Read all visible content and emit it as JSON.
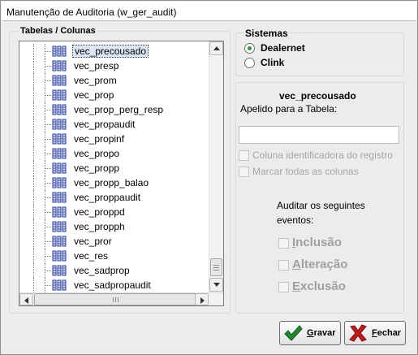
{
  "window": {
    "title": "Manutenção de Auditoria (w_ger_audit)"
  },
  "tables_group": {
    "label": "Tabelas / Colunas",
    "items": [
      {
        "label": "vec_precousado",
        "selected": true
      },
      {
        "label": "vec_presp"
      },
      {
        "label": "vec_prom"
      },
      {
        "label": "vec_prop"
      },
      {
        "label": "vec_prop_perg_resp"
      },
      {
        "label": "vec_propaudit"
      },
      {
        "label": "vec_propinf"
      },
      {
        "label": "vec_propo"
      },
      {
        "label": "vec_propp"
      },
      {
        "label": "vec_propp_balao"
      },
      {
        "label": "vec_proppaudit"
      },
      {
        "label": "vec_proppd"
      },
      {
        "label": "vec_propph"
      },
      {
        "label": "vec_pror"
      },
      {
        "label": "vec_res"
      },
      {
        "label": "vec_sadprop"
      },
      {
        "label": "vec_sadpropaudit"
      }
    ]
  },
  "sistemas": {
    "label": "Sistemas",
    "options": [
      {
        "label": "Dealernet",
        "checked": true
      },
      {
        "label": "Clink",
        "checked": false
      }
    ]
  },
  "table_panel": {
    "selected_table": "vec_precousado",
    "alias_label": "Apelido para a Tabela:",
    "alias_value": "",
    "identifier_checkbox": "Coluna identificadora do registro",
    "mark_all_checkbox": "Marcar todas as colunas",
    "audit_label_line1": "Auditar os seguintes",
    "audit_label_line2": "eventos:",
    "events": [
      {
        "mnemonic": "I",
        "rest": "nclusão"
      },
      {
        "mnemonic": "A",
        "rest": "lteração"
      },
      {
        "mnemonic": "E",
        "rest": "xclusão"
      }
    ]
  },
  "buttons": {
    "save": {
      "mnemonic": "G",
      "rest": "ravar"
    },
    "close": {
      "mnemonic": "F",
      "rest": "echar"
    }
  },
  "colors": {
    "radio_selected": "#27953a",
    "save_icon": "#1f8a2b",
    "close_icon": "#c21a1a",
    "table_icon": "#2a3f9a"
  }
}
